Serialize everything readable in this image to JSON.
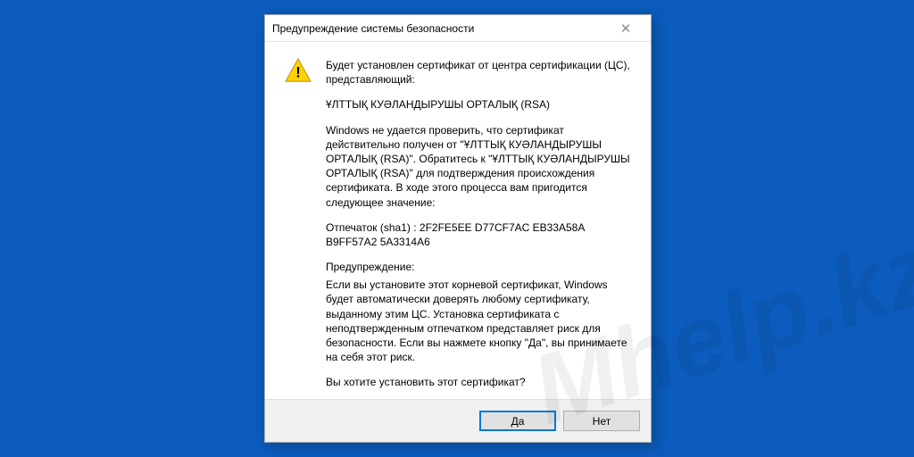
{
  "dialog": {
    "title": "Предупреждение системы безопасности",
    "close_glyph": "✕",
    "intro": "Будет установлен сертификат от центра сертификации (ЦС), представляющий:",
    "ca_name": "ҰЛТТЫҚ КУӘЛАНДЫРУШЫ ОРТАЛЫҚ (RSA)",
    "verify_text": "Windows не удается проверить, что сертификат действительно получен от \"ҰЛТТЫҚ КУӘЛАНДЫРУШЫ ОРТАЛЫҚ (RSA)\". Обратитесь к \"ҰЛТТЫҚ КУӘЛАНДЫРУШЫ ОРТАЛЫҚ (RSA)\" для подтверждения происхождения сертификата. В ходе этого процесса вам пригодится следующее значение:",
    "thumbprint": "Отпечаток (sha1) : 2F2FE5EE D77CF7AC EB33A58A B9FF57A2 5A3314A6",
    "warning_header": "Предупреждение:",
    "warning_body": "Если вы установите этот корневой сертификат, Windows будет автоматически доверять любому сертификату, выданному этим ЦС. Установка сертификата с неподтвержденным отпечатком представляет риск для безопасности. Если вы нажмете кнопку \"Да\", вы принимаете на себя этот риск.",
    "question": "Вы хотите установить этот сертификат?",
    "yes_label": "Да",
    "no_label": "Нет"
  },
  "watermark": "Mhelp.kz"
}
